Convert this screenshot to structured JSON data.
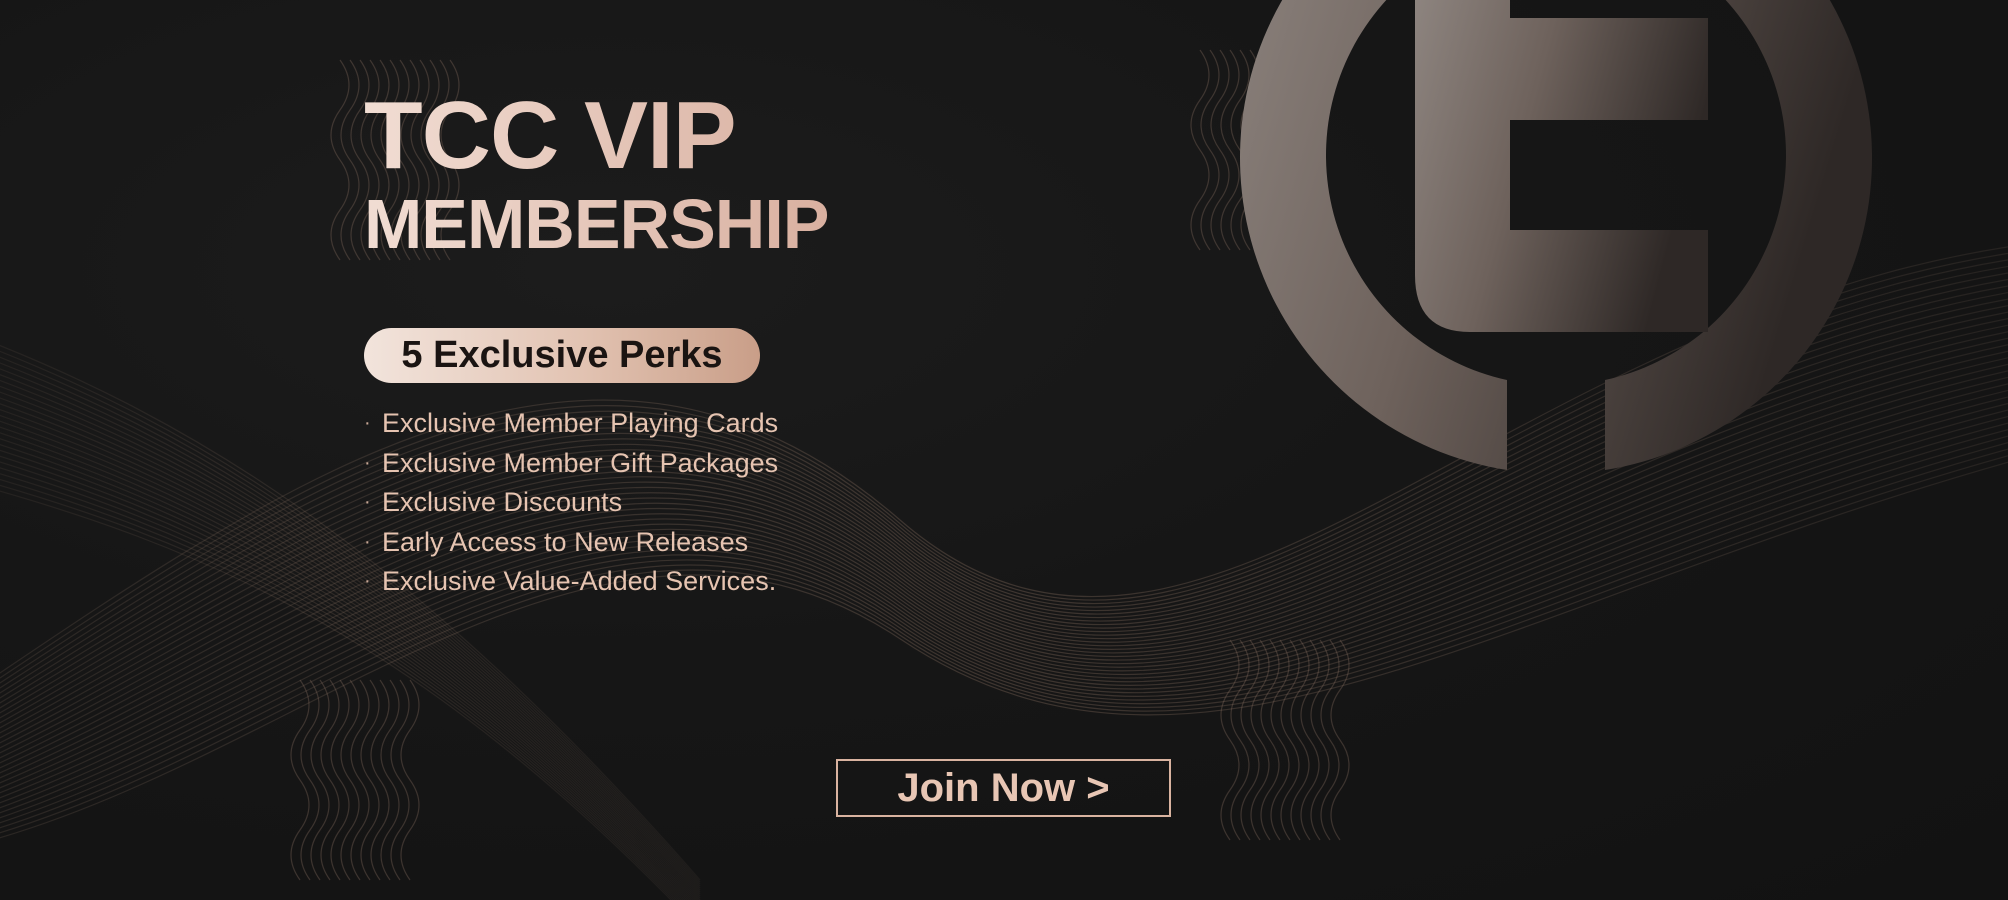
{
  "banner": {
    "title_line1": "TCC VIP",
    "title_line2": "MEMBERSHIP",
    "perks_badge_label": "5 Exclusive Perks",
    "bullet": "·",
    "perks": [
      "Exclusive Member Playing Cards",
      "Exclusive Member Gift Packages",
      "Exclusive Discounts",
      "Early Access to New Releases",
      "Exclusive Value-Added Services."
    ],
    "join_button_label": "Join Now >"
  },
  "colors": {
    "background": "#141414",
    "accent_light": "#f1ddd3",
    "accent_rose_gold": "#d9b0a0",
    "text_perk": "#e6c4b1",
    "badge_text": "#1a1412"
  },
  "icons": {
    "logo": "tcc-logo-icon",
    "decoration": "wave-lines-pattern"
  }
}
